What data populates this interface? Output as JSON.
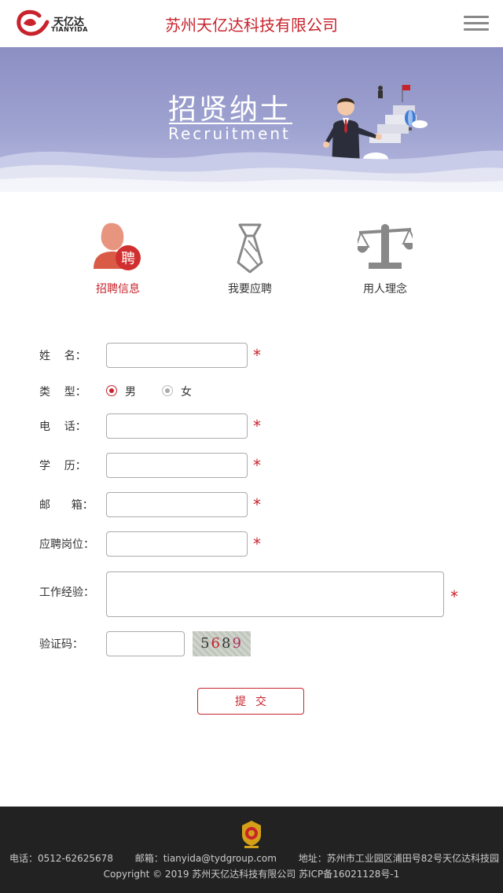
{
  "header": {
    "logo_cn": "天亿达",
    "logo_en": "TIANYIDA",
    "company_title": "苏州天亿达科技有限公司"
  },
  "banner": {
    "title": "招贤纳士",
    "subtitle": "Recruitment"
  },
  "tabs": [
    {
      "label": "招聘信息",
      "icon": "recruit-person-icon",
      "active": true,
      "badge": "聘"
    },
    {
      "label": "我要应聘",
      "icon": "tie-icon",
      "active": false
    },
    {
      "label": "用人理念",
      "icon": "scale-icon",
      "active": false
    }
  ],
  "form": {
    "name_label": "姓    名：",
    "type_label": "类    型：",
    "gender_options": [
      {
        "label": "男",
        "selected": true
      },
      {
        "label": "女",
        "selected": false
      }
    ],
    "phone_label": "电    话：",
    "education_label": "学    历：",
    "email_label": "邮      箱：",
    "position_label": "应聘岗位：",
    "experience_label": "工作经验：",
    "captcha_label": "验证码：",
    "captcha_text": "5689",
    "required_mark": "*",
    "submit_label": "提交"
  },
  "footer": {
    "phone": "电话：0512-62625678",
    "email": "邮箱：tianyida@tydgroup.com",
    "address": "地址：苏州市工业园区浦田号82号天亿达科技园",
    "copyright": "Copyright © 2019 苏州天亿达科技有限公司  苏ICP备16021128号-1"
  },
  "colors": {
    "accent": "#c8232c",
    "banner": "#9ea2d0",
    "footer_bg": "#222222"
  }
}
